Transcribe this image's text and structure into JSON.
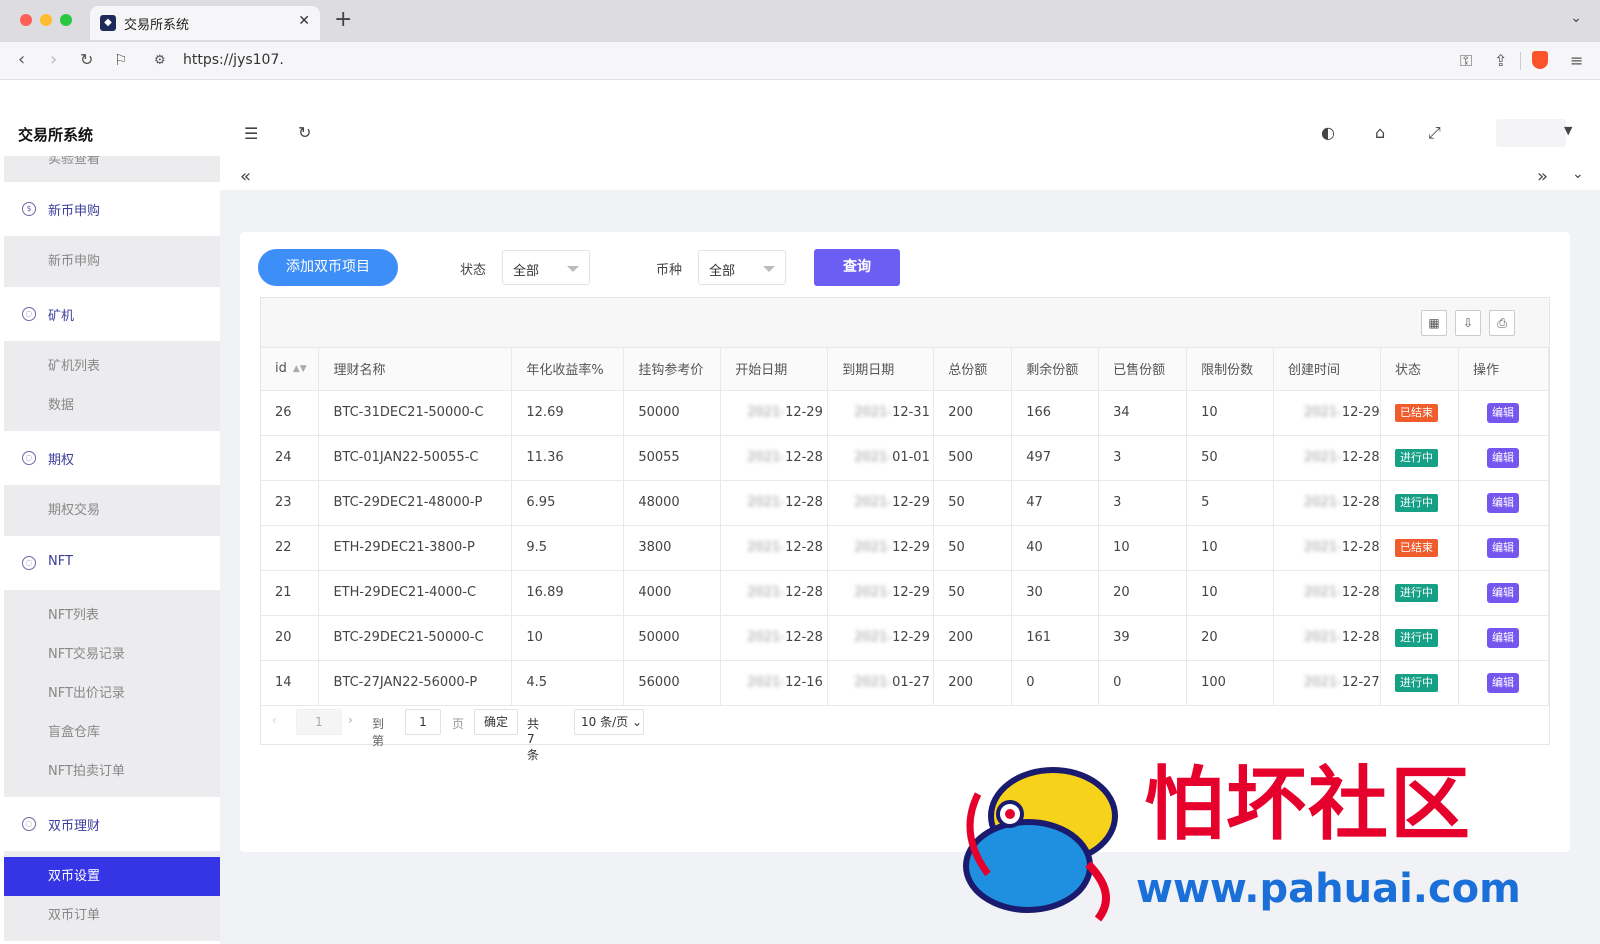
{
  "browser": {
    "tab_title": "交易所系统",
    "url": "https://jys107."
  },
  "sidebar": {
    "brand": "交易所系统",
    "cut_item": "实验查看",
    "groups": [
      {
        "label": "新币申购",
        "items": [
          "新币申购"
        ]
      },
      {
        "label": "矿机",
        "items": [
          "矿机列表",
          "数据"
        ]
      },
      {
        "label": "期权",
        "items": [
          "期权交易"
        ]
      },
      {
        "label": "NFT",
        "items": [
          "NFT列表",
          "NFT交易记录",
          "NFT出价记录",
          "盲盒仓库",
          "NFT拍卖订单"
        ]
      },
      {
        "label": "双币理财",
        "items": [
          "双币设置",
          "双币订单"
        ]
      }
    ]
  },
  "filters": {
    "add_button": "添加双币项目",
    "status_label": "状态",
    "status_value": "全部",
    "coin_label": "币种",
    "coin_value": "全部",
    "query_button": "查询"
  },
  "table": {
    "columns": [
      "id",
      "理财名称",
      "年化收益率%",
      "挂钩参考价",
      "开始日期",
      "到期日期",
      "总份额",
      "剩余份额",
      "已售份额",
      "限制份数",
      "创建时间",
      "状态",
      "操作"
    ],
    "edit_label": "编辑",
    "rows": [
      {
        "id": "26",
        "name": "BTC-31DEC21-50000-C",
        "rate": "12.69",
        "price": "50000",
        "start": "12-29",
        "end": "12-31",
        "total": "200",
        "remain": "166",
        "sold": "34",
        "limit": "10",
        "created": "12-29",
        "status": "已结束",
        "status_type": "end"
      },
      {
        "id": "24",
        "name": "BTC-01JAN22-50055-C",
        "rate": "11.36",
        "price": "50055",
        "start": "12-28",
        "end": "01-01",
        "total": "500",
        "remain": "497",
        "sold": "3",
        "limit": "50",
        "created": "12-28",
        "status": "进行中",
        "status_type": "run"
      },
      {
        "id": "23",
        "name": "BTC-29DEC21-48000-P",
        "rate": "6.95",
        "price": "48000",
        "start": "12-28",
        "end": "12-29",
        "total": "50",
        "remain": "47",
        "sold": "3",
        "limit": "5",
        "created": "12-28",
        "status": "进行中",
        "status_type": "run"
      },
      {
        "id": "22",
        "name": "ETH-29DEC21-3800-P",
        "rate": "9.5",
        "price": "3800",
        "start": "12-28",
        "end": "12-29",
        "total": "50",
        "remain": "40",
        "sold": "10",
        "limit": "10",
        "created": "12-28",
        "status": "已结束",
        "status_type": "end"
      },
      {
        "id": "21",
        "name": "ETH-29DEC21-4000-C",
        "rate": "16.89",
        "price": "4000",
        "start": "12-28",
        "end": "12-29",
        "total": "50",
        "remain": "30",
        "sold": "20",
        "limit": "10",
        "created": "12-28",
        "status": "进行中",
        "status_type": "run"
      },
      {
        "id": "20",
        "name": "BTC-29DEC21-50000-C",
        "rate": "10",
        "price": "50000",
        "start": "12-28",
        "end": "12-29",
        "total": "200",
        "remain": "161",
        "sold": "39",
        "limit": "20",
        "created": "12-28",
        "status": "进行中",
        "status_type": "run"
      },
      {
        "id": "14",
        "name": "BTC-27JAN22-56000-P",
        "rate": "4.5",
        "price": "56000",
        "start": "12-16",
        "end": "01-27",
        "total": "200",
        "remain": "0",
        "sold": "0",
        "limit": "100",
        "created": "12-27",
        "status": "进行中",
        "status_type": "run"
      }
    ]
  },
  "pager": {
    "current": "1",
    "goto_label": "到第",
    "goto_value": "1",
    "page_label": "页",
    "confirm": "确定",
    "total": "共 7 条",
    "page_size": "10 条/页"
  },
  "watermark": {
    "cn": "怕坏社区",
    "url": "www.pahuai.com"
  },
  "colors": {
    "primary_blue": "#3e8ef7",
    "query_purple": "#6c5ef2",
    "menu_active": "#3535e6",
    "status_end": "#f05d2d",
    "status_run": "#16a085"
  }
}
